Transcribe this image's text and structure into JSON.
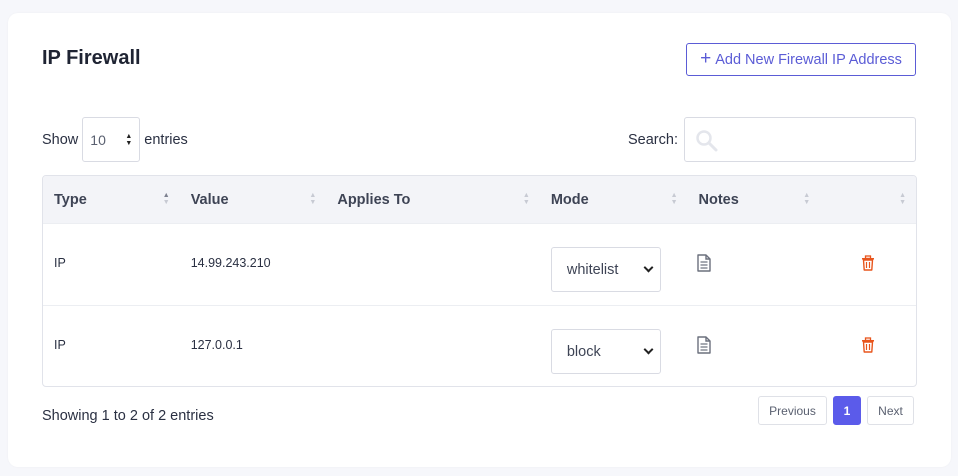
{
  "page": {
    "title": "IP Firewall"
  },
  "actions": {
    "add_label": "Add New Firewall IP Address",
    "add_icon": "plus-icon"
  },
  "length": {
    "show_label": "Show",
    "value": "10",
    "entries_label": "entries"
  },
  "search": {
    "label": "Search:",
    "value": "",
    "icon": "search-icon"
  },
  "table": {
    "columns": [
      "Type",
      "Value",
      "Applies To",
      "Mode",
      "Notes",
      ""
    ],
    "sorted_column": "Type",
    "rows": [
      {
        "type": "IP",
        "value": "14.99.243.210",
        "applies_to": "",
        "mode": "whitelist"
      },
      {
        "type": "IP",
        "value": "127.0.0.1",
        "applies_to": "",
        "mode": "block"
      }
    ]
  },
  "footer": {
    "info": "Showing 1 to 2 of 2 entries",
    "previous": "Previous",
    "current_page": "1",
    "next": "Next"
  },
  "colors": {
    "accent": "#5b5cd6",
    "active_page": "#5b5bea",
    "delete": "#e8551c"
  }
}
